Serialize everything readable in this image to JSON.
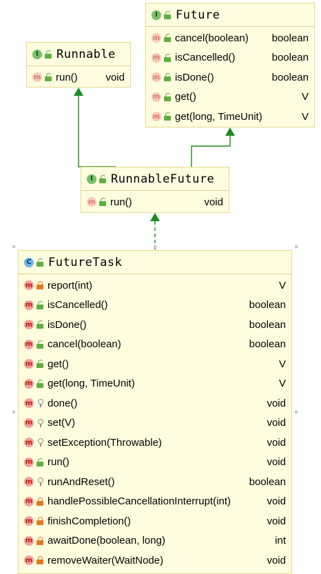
{
  "classes": {
    "future": {
      "kind": "I",
      "name": "Future",
      "members": [
        {
          "name": "cancel(boolean)",
          "ret": "boolean"
        },
        {
          "name": "isCancelled()",
          "ret": "boolean"
        },
        {
          "name": "isDone()",
          "ret": "boolean"
        },
        {
          "name": "get()",
          "ret": "V"
        },
        {
          "name": "get(long, TimeUnit)",
          "ret": "V"
        }
      ]
    },
    "runnable": {
      "kind": "I",
      "name": "Runnable",
      "members": [
        {
          "name": "run()",
          "ret": "void"
        }
      ]
    },
    "runnable_future": {
      "kind": "I",
      "name": "RunnableFuture",
      "members": [
        {
          "name": "run()",
          "ret": "void"
        }
      ]
    },
    "future_task": {
      "kind": "C",
      "name": "FutureTask",
      "members": [
        {
          "name": "report(int)",
          "ret": "V"
        },
        {
          "name": "isCancelled()",
          "ret": "boolean"
        },
        {
          "name": "isDone()",
          "ret": "boolean"
        },
        {
          "name": "cancel(boolean)",
          "ret": "boolean"
        },
        {
          "name": "get()",
          "ret": "V"
        },
        {
          "name": "get(long, TimeUnit)",
          "ret": "V"
        },
        {
          "name": "done()",
          "ret": "void"
        },
        {
          "name": "set(V)",
          "ret": "void"
        },
        {
          "name": "setException(Throwable)",
          "ret": "void"
        },
        {
          "name": "run()",
          "ret": "void"
        },
        {
          "name": "runAndReset()",
          "ret": "boolean"
        },
        {
          "name": "handlePossibleCancellationInterrupt(int)",
          "ret": "void"
        },
        {
          "name": "finishCompletion()",
          "ret": "void"
        },
        {
          "name": "awaitDone(boolean, long)",
          "ret": "int"
        },
        {
          "name": "removeWaiter(WaitNode)",
          "ret": "void"
        }
      ]
    }
  },
  "member_badge": "m",
  "colors": {
    "box_fill": "#fffde0",
    "box_border": "#e4d98a",
    "arrow": "#1c8a1c",
    "method_badge": "#f4a19a",
    "interface_badge": "#77c069",
    "class_badge": "#6fb6ea"
  }
}
